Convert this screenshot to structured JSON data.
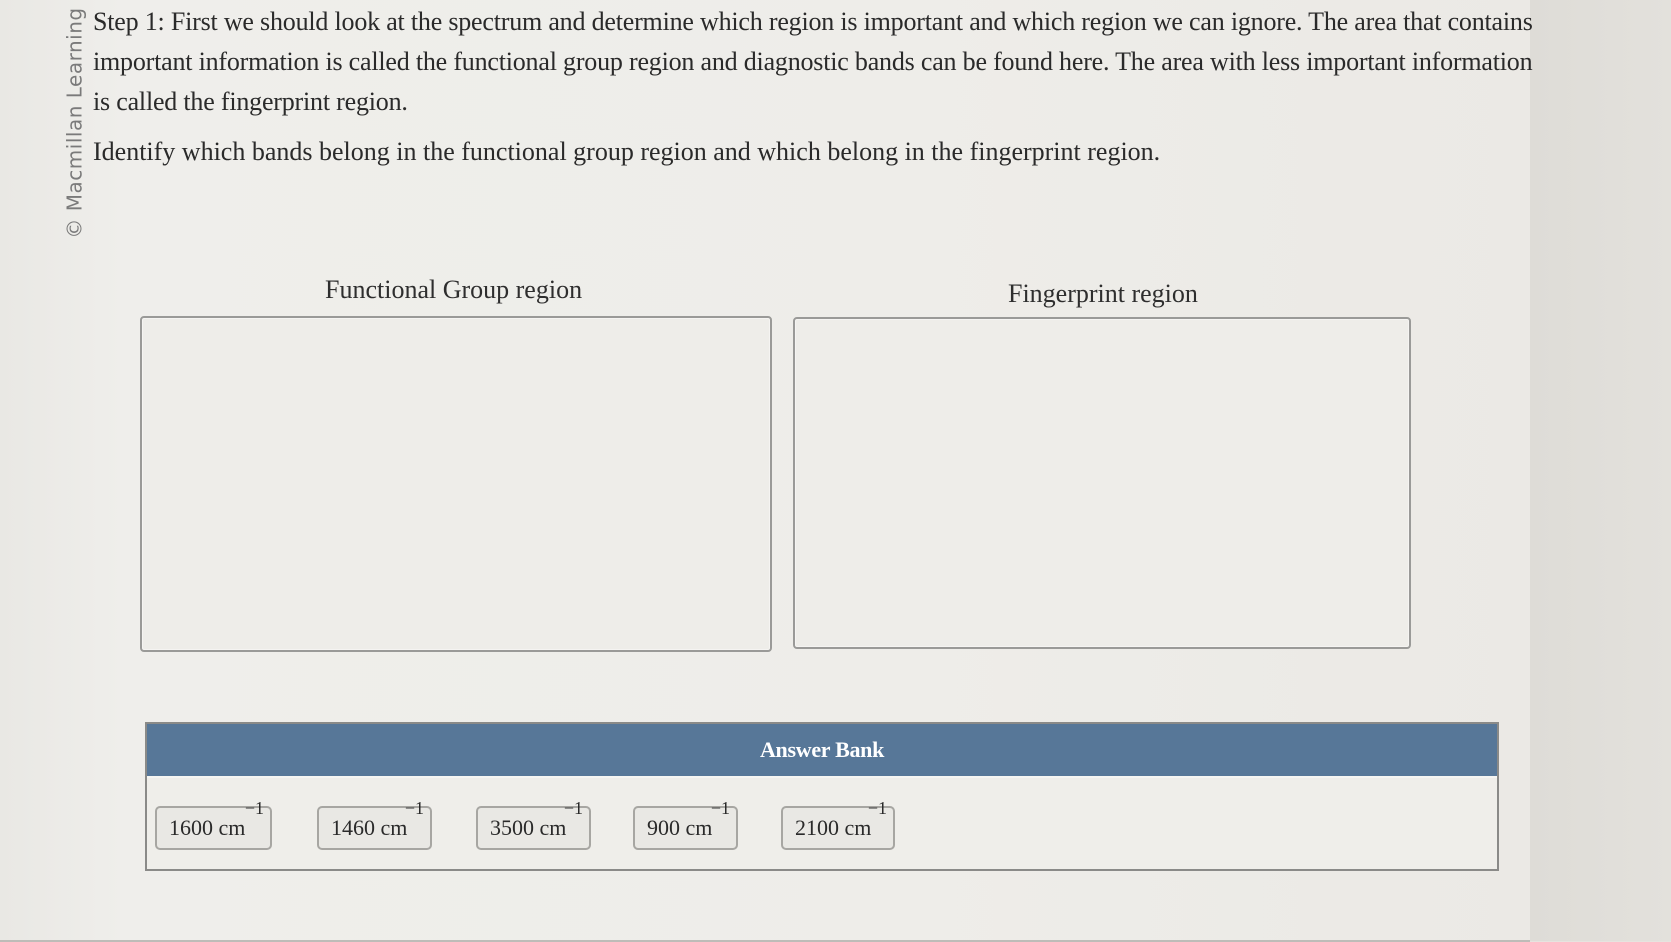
{
  "watermark": "© Macmillan Learning",
  "instructions": {
    "step_text": "Step 1: First we should look at the spectrum and determine which region is important and which region we can ignore. The area that contains important information is called the functional group region and diagnostic bands can be found here. The area with less important information is called the fingerprint region.",
    "prompt_text": "Identify which bands belong in the functional group region and which belong in the fingerprint region."
  },
  "dropzones": {
    "functional": {
      "label": "Functional Group region",
      "items": []
    },
    "fingerprint": {
      "label": "Fingerprint region",
      "items": []
    }
  },
  "answer_bank": {
    "title": "Answer Bank",
    "items": [
      {
        "value": "1600 cm",
        "exponent": "−1"
      },
      {
        "value": "1460 cm",
        "exponent": "−1"
      },
      {
        "value": "3500 cm",
        "exponent": "−1"
      },
      {
        "value": "900 cm",
        "exponent": "−1"
      },
      {
        "value": "2100 cm",
        "exponent": "−1"
      }
    ]
  },
  "colors": {
    "answer_bank_header": "#577798",
    "page_background": "#eeede9"
  }
}
